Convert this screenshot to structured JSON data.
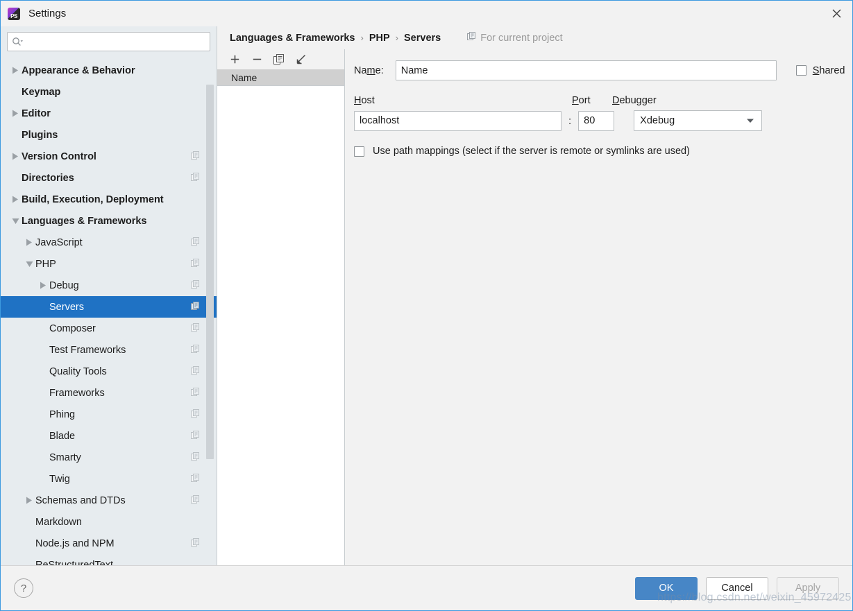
{
  "window": {
    "title": "Settings",
    "logo_icon": "phpstorm-logo",
    "close_icon": "close-icon"
  },
  "sidebar": {
    "search": {
      "value": "",
      "placeholder": "",
      "icon": "search-icon"
    },
    "items": [
      {
        "label": "Appearance & Behavior",
        "indent": 0,
        "arrow": "collapsed",
        "bold": true,
        "project_icon": false,
        "selected": false
      },
      {
        "label": "Keymap",
        "indent": 0,
        "arrow": "none",
        "bold": true,
        "project_icon": false,
        "selected": false
      },
      {
        "label": "Editor",
        "indent": 0,
        "arrow": "collapsed",
        "bold": true,
        "project_icon": false,
        "selected": false
      },
      {
        "label": "Plugins",
        "indent": 0,
        "arrow": "none",
        "bold": true,
        "project_icon": false,
        "selected": false
      },
      {
        "label": "Version Control",
        "indent": 0,
        "arrow": "collapsed",
        "bold": true,
        "project_icon": true,
        "selected": false
      },
      {
        "label": "Directories",
        "indent": 0,
        "arrow": "none",
        "bold": true,
        "project_icon": true,
        "selected": false
      },
      {
        "label": "Build, Execution, Deployment",
        "indent": 0,
        "arrow": "collapsed",
        "bold": true,
        "project_icon": false,
        "selected": false
      },
      {
        "label": "Languages & Frameworks",
        "indent": 0,
        "arrow": "expanded",
        "bold": true,
        "project_icon": false,
        "selected": false
      },
      {
        "label": "JavaScript",
        "indent": 1,
        "arrow": "collapsed",
        "bold": false,
        "project_icon": true,
        "selected": false
      },
      {
        "label": "PHP",
        "indent": 1,
        "arrow": "expanded",
        "bold": false,
        "project_icon": true,
        "selected": false
      },
      {
        "label": "Debug",
        "indent": 2,
        "arrow": "collapsed",
        "bold": false,
        "project_icon": true,
        "selected": false
      },
      {
        "label": "Servers",
        "indent": 2,
        "arrow": "none",
        "bold": false,
        "project_icon": true,
        "selected": true
      },
      {
        "label": "Composer",
        "indent": 2,
        "arrow": "none",
        "bold": false,
        "project_icon": true,
        "selected": false
      },
      {
        "label": "Test Frameworks",
        "indent": 2,
        "arrow": "none",
        "bold": false,
        "project_icon": true,
        "selected": false
      },
      {
        "label": "Quality Tools",
        "indent": 2,
        "arrow": "none",
        "bold": false,
        "project_icon": true,
        "selected": false
      },
      {
        "label": "Frameworks",
        "indent": 2,
        "arrow": "none",
        "bold": false,
        "project_icon": true,
        "selected": false
      },
      {
        "label": "Phing",
        "indent": 2,
        "arrow": "none",
        "bold": false,
        "project_icon": true,
        "selected": false
      },
      {
        "label": "Blade",
        "indent": 2,
        "arrow": "none",
        "bold": false,
        "project_icon": true,
        "selected": false
      },
      {
        "label": "Smarty",
        "indent": 2,
        "arrow": "none",
        "bold": false,
        "project_icon": true,
        "selected": false
      },
      {
        "label": "Twig",
        "indent": 2,
        "arrow": "none",
        "bold": false,
        "project_icon": true,
        "selected": false
      },
      {
        "label": "Schemas and DTDs",
        "indent": 1,
        "arrow": "collapsed",
        "bold": false,
        "project_icon": true,
        "selected": false
      },
      {
        "label": "Markdown",
        "indent": 1,
        "arrow": "none",
        "bold": false,
        "project_icon": false,
        "selected": false
      },
      {
        "label": "Node.js and NPM",
        "indent": 1,
        "arrow": "none",
        "bold": false,
        "project_icon": true,
        "selected": false
      },
      {
        "label": "ReStructuredText",
        "indent": 1,
        "arrow": "none",
        "bold": false,
        "project_icon": false,
        "selected": false
      }
    ]
  },
  "breadcrumb": {
    "items": [
      "Languages & Frameworks",
      "PHP",
      "Servers"
    ],
    "separator": "›",
    "scope_label": "For current project",
    "scope_icon": "project-scope-icon"
  },
  "list_panel": {
    "toolbar": [
      {
        "name": "add-server-button",
        "icon": "plus-icon"
      },
      {
        "name": "remove-server-button",
        "icon": "minus-icon"
      },
      {
        "name": "copy-server-button",
        "icon": "copy-icon"
      },
      {
        "name": "import-server-button",
        "icon": "arrow-down-left-icon"
      }
    ],
    "column_header": "Name",
    "rows": []
  },
  "form": {
    "name_label": "Na",
    "name_label_mnemonic": "m",
    "name_label_rest": "e:",
    "name_value": "Name",
    "shared_label_mnemonic": "S",
    "shared_label_rest": "hared",
    "shared_checked": false,
    "host_label_mnemonic": "H",
    "host_label_rest": "ost",
    "host_value": "localhost",
    "separator": ":",
    "port_label_mnemonic": "P",
    "port_label_rest": "ort",
    "port_value": "80",
    "debugger_label_mnemonic": "D",
    "debugger_label_rest": "ebugger",
    "debugger_value": "Xdebug",
    "debugger_options": [
      "Xdebug"
    ],
    "path_mappings_label": "Use path mappings (select if the server is remote or symlinks are used)",
    "path_mappings_checked": false
  },
  "footer": {
    "help_label": "?",
    "ok_label": "OK",
    "cancel_label": "Cancel",
    "apply_label": "Apply"
  },
  "watermark": {
    "text": "https://blog.csdn.net/weixin_45972425"
  },
  "colors": {
    "accent": "#1f72c4",
    "primary_button": "#4786c6",
    "sidebar_bg": "#e7ecef",
    "window_border": "#3d9ae0"
  }
}
